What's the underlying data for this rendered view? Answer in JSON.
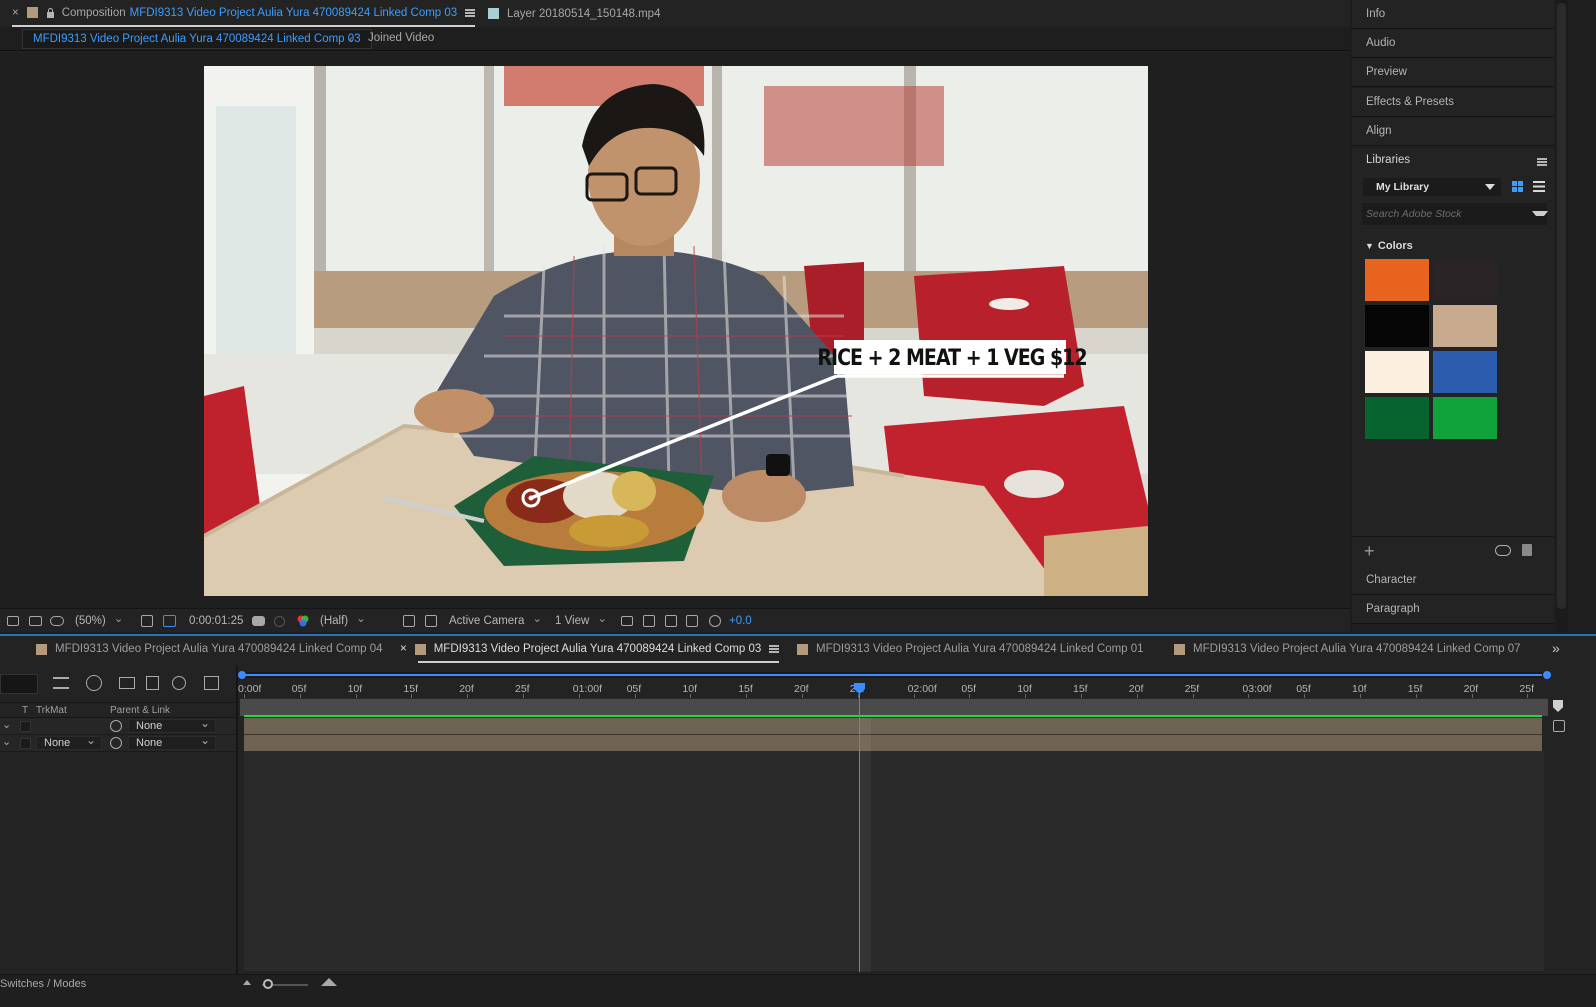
{
  "composition_panel": {
    "tab_close": "×",
    "tab_prefix": "Composition",
    "tab_name": "MFDI9313 Video Project Aulia Yura 470089424 Linked Comp 03",
    "layer_tab": "Layer  20180514_150148.mp4",
    "breadcrumb_active": "MFDI9313 Video Project Aulia Yura 470089424 Linked Comp 03",
    "breadcrumb_sep": "‹",
    "breadcrumb_next": "Joined Video"
  },
  "viewer": {
    "overlay_text": "RICE + 2 MEAT + 1 VEG $12",
    "toolbar": {
      "zoom": "(50%)",
      "timecode": "0:00:01:25",
      "resolution": "(Half)",
      "camera": "Active Camera",
      "views": "1 View",
      "exposure": "+0.0"
    }
  },
  "right_panels": {
    "items_top": [
      "Info",
      "Audio",
      "Preview",
      "Effects & Presets",
      "Align"
    ],
    "libraries": {
      "title": "Libraries",
      "library_name": "My Library",
      "search_placeholder": "Search Adobe Stock",
      "section": "Colors",
      "swatches": [
        "#e8641e",
        "#2a2426",
        "#050505",
        "#c8ab8e",
        "#fbf0df",
        "#2c5cad",
        "#06642f",
        "#10a33b"
      ]
    },
    "items_bottom": [
      "Character",
      "Paragraph"
    ]
  },
  "timeline": {
    "tabs": [
      {
        "label": "MFDI9313 Video Project Aulia Yura 470089424 Linked Comp 04",
        "active": false
      },
      {
        "label": "MFDI9313 Video Project Aulia Yura 470089424 Linked Comp 03",
        "active": true
      },
      {
        "label": "MFDI9313 Video Project Aulia Yura 470089424 Linked Comp 01",
        "active": false
      },
      {
        "label": "MFDI9313 Video Project Aulia Yura 470089424 Linked Comp 07",
        "active": false
      }
    ],
    "tab_close": "×",
    "columns": {
      "t": "T",
      "trkmat": "TrkMat",
      "parent": "Parent & Link"
    },
    "rows": [
      {
        "trkmat": "",
        "parent": "None"
      },
      {
        "trkmat": "None",
        "parent": "None"
      }
    ],
    "ruler_labels": [
      "0:00f",
      "05f",
      "10f",
      "15f",
      "20f",
      "25f",
      "01:00f",
      "05f",
      "10f",
      "15f",
      "20f",
      "25f",
      "02:00f",
      "05f",
      "10f",
      "15f",
      "20f",
      "25f",
      "03:00f",
      "05f",
      "10f",
      "15f",
      "20f",
      "25f"
    ],
    "footer": {
      "switches_modes": "Switches / Modes"
    }
  }
}
